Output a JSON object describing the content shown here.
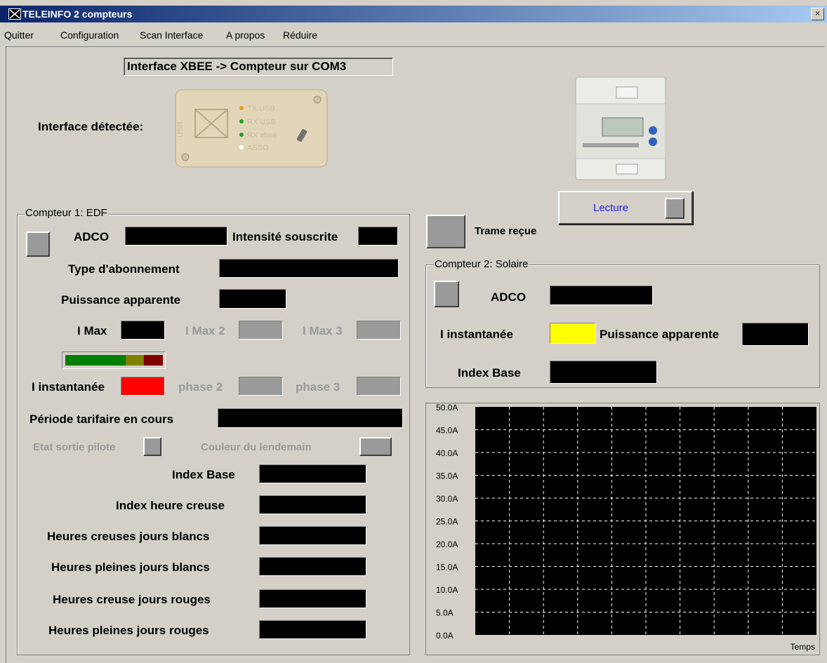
{
  "window": {
    "title": "TELEINFO 2 compteurs",
    "close_glyph": "×"
  },
  "menu": {
    "items": [
      "Quitter",
      "Configuration",
      "Scan Interface",
      "A propos",
      "Réduire"
    ]
  },
  "interface": {
    "status": "Interface XBEE -> Compteur sur COM3",
    "detected_label": "Interface détectée:",
    "device_leds": [
      "TX USB",
      "RX USB",
      "RX xbee",
      "ASSO"
    ],
    "device_brand": "USB"
  },
  "reading": {
    "button_label": "Lecture",
    "frame_received_label": "Trame reçue"
  },
  "compteur1": {
    "title": "Compteur 1: EDF",
    "adco_label": "ADCO",
    "intensite_souscrite_label": "Intensité souscrite",
    "type_abonnement_label": "Type d'abonnement",
    "puissance_apparente_label": "Puissance apparente",
    "imax_label": "I Max",
    "imax2_label": "I Max 2",
    "imax3_label": "I Max 3",
    "instantanee_label": "I instantanée",
    "phase2_label": "phase 2",
    "phase3_label": "phase 3",
    "periode_label": "Période tarifaire en cours",
    "etat_sortie_label": "Etat sortie pilote",
    "couleur_lendemain_label": "Couleur du lendemain",
    "index_labels": [
      "Index Base",
      "Index heure creuse",
      "Heures creuses jours blancs",
      "Heures pleines jours blancs",
      "Heures creuse jours rouges",
      "Heures pleines jours rouges"
    ],
    "level_colors": [
      "#008000",
      "#808000",
      "#800000"
    ]
  },
  "compteur2": {
    "title": "Compteur 2: Solaire",
    "adco_label": "ADCO",
    "instantanee_label": "I instantanée",
    "puissance_apparente_label": "Puissance apparente",
    "index_base_label": "Index Base"
  },
  "chart_data": {
    "type": "line",
    "title": "",
    "xlabel": "Temps",
    "ylabel": "",
    "ylim": [
      0,
      50
    ],
    "y_ticks": [
      "0.0A",
      "5.0A",
      "10.0A",
      "15.0A",
      "20.0A",
      "25.0A",
      "30.0A",
      "35.0A",
      "40.0A",
      "45.0A",
      "50.0A"
    ],
    "series": [],
    "grid": true,
    "background": "#000000"
  }
}
